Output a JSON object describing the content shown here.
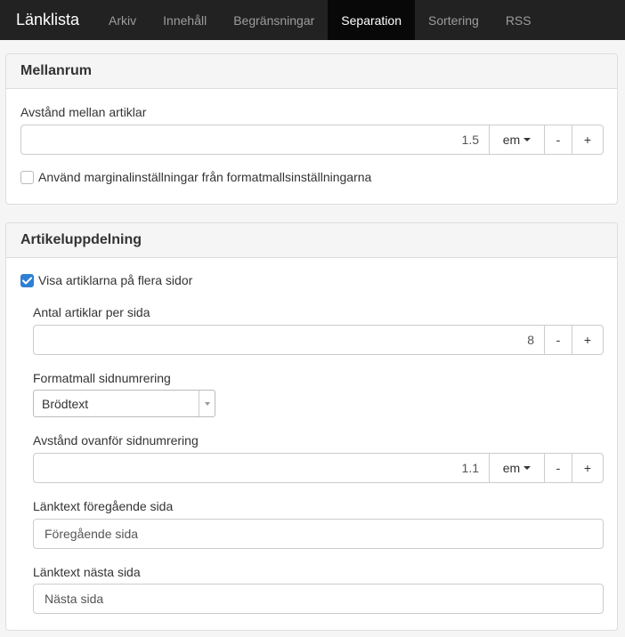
{
  "navbar": {
    "brand": "Länklista",
    "tabs": [
      {
        "label": "Arkiv"
      },
      {
        "label": "Innehåll"
      },
      {
        "label": "Begränsningar"
      },
      {
        "label": "Separation"
      },
      {
        "label": "Sortering"
      },
      {
        "label": "RSS"
      }
    ],
    "active_tab": "Separation"
  },
  "spacing_panel": {
    "title": "Mellanrum",
    "article_spacing": {
      "label": "Avstånd mellan artiklar",
      "value": "1.5",
      "unit": "em",
      "minus": "-",
      "plus": "+"
    },
    "use_margins_checkbox": {
      "label": "Använd marginalinställningar från formatmallsinställningarna",
      "checked": false
    }
  },
  "pagination_panel": {
    "title": "Artikeluppdelning",
    "multi_page_checkbox": {
      "label": "Visa artiklarna på flera sidor",
      "checked": true
    },
    "articles_per_page": {
      "label": "Antal artiklar per sida",
      "value": "8",
      "minus": "-",
      "plus": "+"
    },
    "pagination_style": {
      "label": "Formatmall sidnumrering",
      "selected": "Brödtext"
    },
    "pagination_spacing": {
      "label": "Avstånd ovanför sidnumrering",
      "value": "1.1",
      "unit": "em",
      "minus": "-",
      "plus": "+"
    },
    "prev_link_text": {
      "label": "Länktext föregående sida",
      "value": "Föregående sida"
    },
    "next_link_text": {
      "label": "Länktext nästa sida",
      "value": "Nästa sida"
    }
  },
  "colors": {
    "navbar_bg": "#222222",
    "active_tab_bg": "#080808",
    "checkbox_checked": "#2f7fd4"
  }
}
